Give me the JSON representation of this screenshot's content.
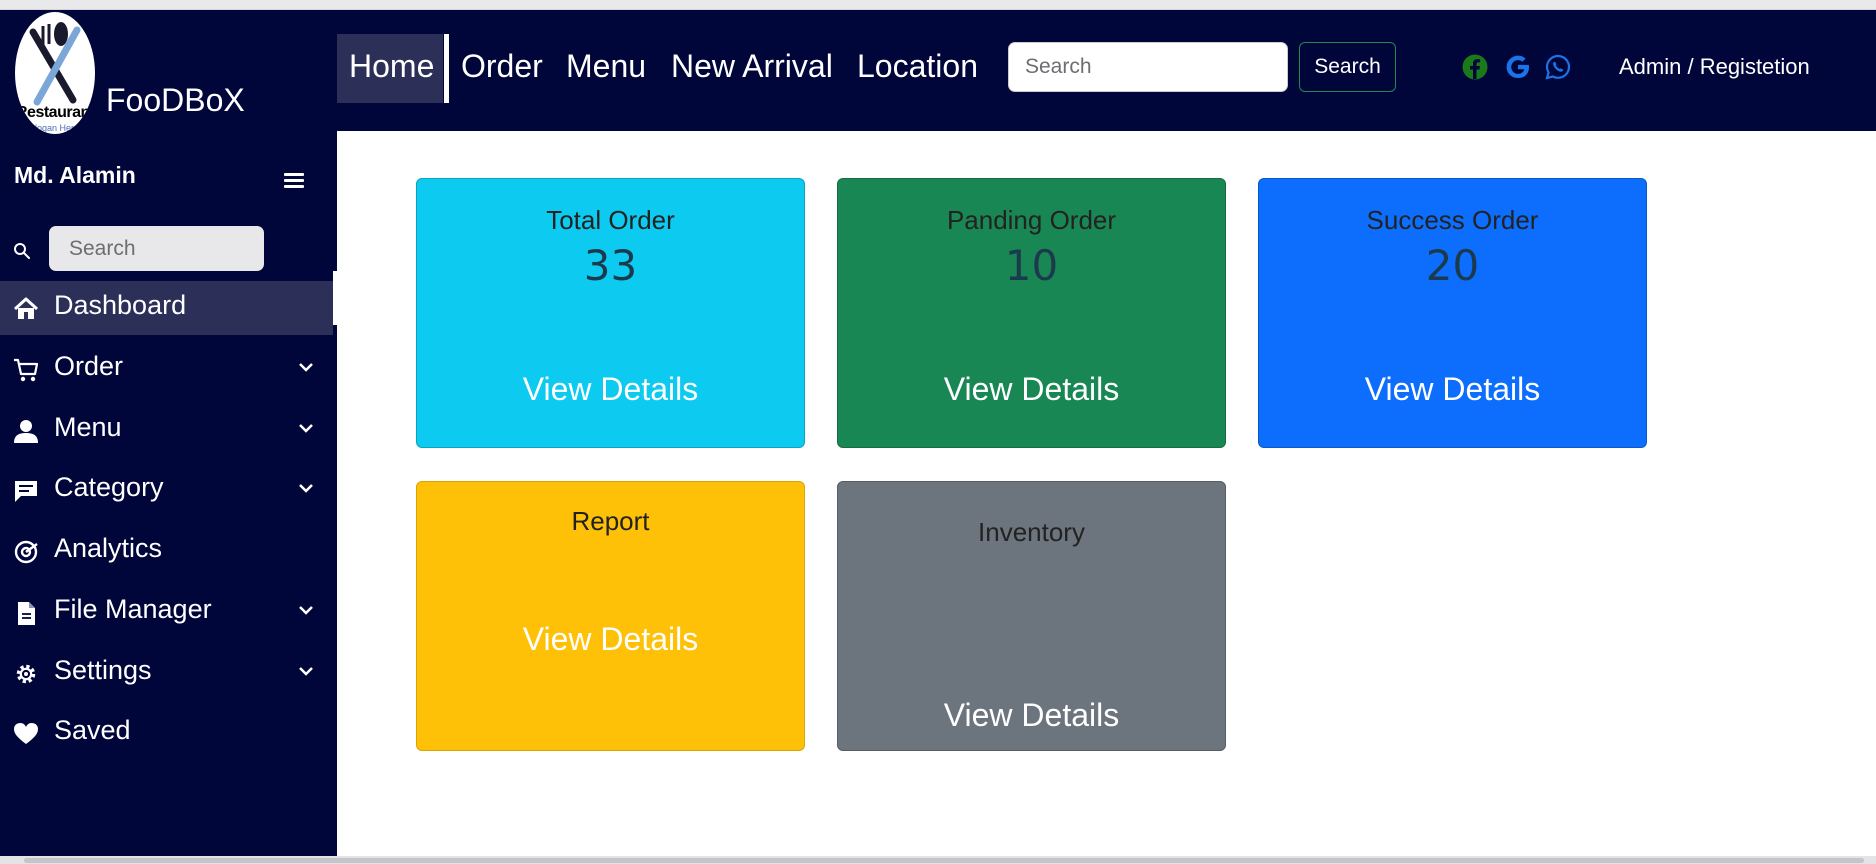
{
  "colors": {
    "sidebar_bg": "#00053a",
    "active_bg": "#2c2f57",
    "card_info": "#0dcaf0",
    "card_success": "#198754",
    "card_primary": "#0d6efd",
    "card_warning": "#ffc107",
    "card_secondary": "#6c757d"
  },
  "brand": {
    "logo_text": "Restaurant",
    "logo_subtext": "Slogan Here",
    "name": "FooDBoX"
  },
  "sidebar": {
    "user_name": "Md. Alamin",
    "search_placeholder": "Search",
    "items": [
      {
        "label": "Dashboard",
        "icon": "home-icon",
        "active": true,
        "has_submenu": false
      },
      {
        "label": "Order",
        "icon": "cart-icon",
        "active": false,
        "has_submenu": true
      },
      {
        "label": "Menu",
        "icon": "user-icon",
        "active": false,
        "has_submenu": true
      },
      {
        "label": "Category",
        "icon": "chat-icon",
        "active": false,
        "has_submenu": true
      },
      {
        "label": "Analytics",
        "icon": "analytics-icon",
        "active": false,
        "has_submenu": false
      },
      {
        "label": "File Manager",
        "icon": "file-icon",
        "active": false,
        "has_submenu": true
      },
      {
        "label": "Settings",
        "icon": "gear-icon",
        "active": false,
        "has_submenu": true
      },
      {
        "label": "Saved",
        "icon": "heart-icon",
        "active": false,
        "has_submenu": false
      }
    ]
  },
  "topnav": {
    "links": [
      "Home",
      "Order",
      "Menu",
      "New Arrival",
      "Location"
    ],
    "active": "Home",
    "search_placeholder": "Search",
    "search_button": "Search",
    "social_icons": [
      "facebook-icon",
      "google-icon",
      "whatsapp-icon"
    ],
    "account_link": "Admin / Registetion"
  },
  "cards": [
    {
      "title": "Total Order",
      "count": "33",
      "link": "View Details",
      "color": "#0dcaf0"
    },
    {
      "title": "Panding Order",
      "count": "10",
      "link": "View Details",
      "color": "#198754"
    },
    {
      "title": "Success Order",
      "count": "20",
      "link": "View Details",
      "color": "#0d6efd"
    },
    {
      "title": "Report",
      "count": "",
      "link": "View Details",
      "color": "#ffc107"
    },
    {
      "title": "Inventory",
      "count": "",
      "link": "View Details",
      "color": "#6c757d"
    }
  ]
}
